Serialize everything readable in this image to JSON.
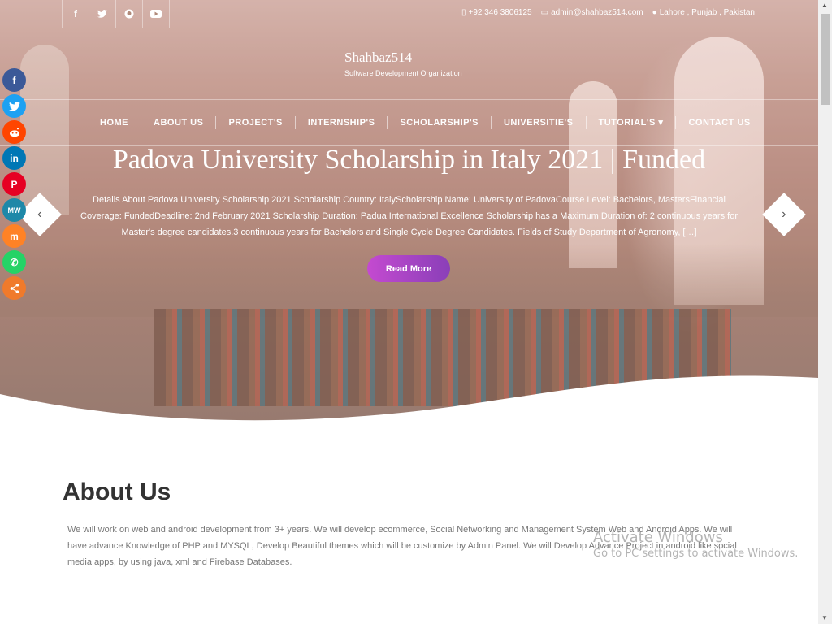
{
  "topbar": {
    "social": [
      {
        "icon": "facebook-icon",
        "glyph": "f"
      },
      {
        "icon": "twitter-icon",
        "glyph": "🐦"
      },
      {
        "icon": "github-icon",
        "glyph": "◉"
      },
      {
        "icon": "youtube-icon",
        "glyph": "▶"
      }
    ],
    "phone": "+92 346 3806125",
    "email": "admin@shahbaz514.com",
    "location": "Lahore , Punjab , Pakistan"
  },
  "brand": {
    "name": "Shahbaz514",
    "tagline": "Software Development Organization"
  },
  "nav": {
    "items": [
      "HOME",
      "ABOUT US",
      "PROJECT'S",
      "INTERNSHIP'S",
      "SCHOLARSHIP'S",
      "UNIVERSITIE'S",
      "TUTORIAL'S ▾",
      "CONTACT US"
    ]
  },
  "hero": {
    "title": "Padova University Scholarship in Italy 2021 | Funded",
    "description": "Details About Padova University Scholarship 2021 Scholarship Country: ItalyScholarship Name: University of PadovaCourse Level: Bachelors, MastersFinancial Coverage: FundedDeadline: 2nd February 2021 Scholarship Duration: Padua International Excellence Scholarship has a Maximum Duration of: 2 continuous years for Master's degree candidates.3 continuous years for Bachelors and Single Cycle Degree Candidates. Fields of Study Department of Agronomy, […]",
    "read_more": "Read More",
    "prev": "‹",
    "next": "›"
  },
  "share": [
    {
      "name": "facebook-share-icon",
      "glyph": "f",
      "color": "#3b5998"
    },
    {
      "name": "twitter-share-icon",
      "glyph": "t",
      "color": "#1da1f2"
    },
    {
      "name": "reddit-share-icon",
      "glyph": "r",
      "color": "#ff4500"
    },
    {
      "name": "linkedin-share-icon",
      "glyph": "in",
      "color": "#0077b5"
    },
    {
      "name": "pinterest-share-icon",
      "glyph": "P",
      "color": "#e60023"
    },
    {
      "name": "mewe-share-icon",
      "glyph": "MW",
      "color": "#1e88a8"
    },
    {
      "name": "mix-share-icon",
      "glyph": "m",
      "color": "#ff8226"
    },
    {
      "name": "whatsapp-share-icon",
      "glyph": "✆",
      "color": "#25d366"
    },
    {
      "name": "more-share-icon",
      "glyph": "⋖",
      "color": "#f07a2b"
    }
  ],
  "about": {
    "title": "About Us",
    "text": "We will work on web and android development from 3+ years. We will develop ecommerce, Social Networking and Management System Web and Android Apps. We will have advance Knowledge of PHP and MYSQL, Develop Beautiful themes which will be customize by Admin Panel. We will Develop Advance Project in android like social media apps, by using java, xml and Firebase Databases."
  },
  "watermark": {
    "line1": "Activate Windows",
    "line2": "Go to PC settings to activate Windows."
  }
}
